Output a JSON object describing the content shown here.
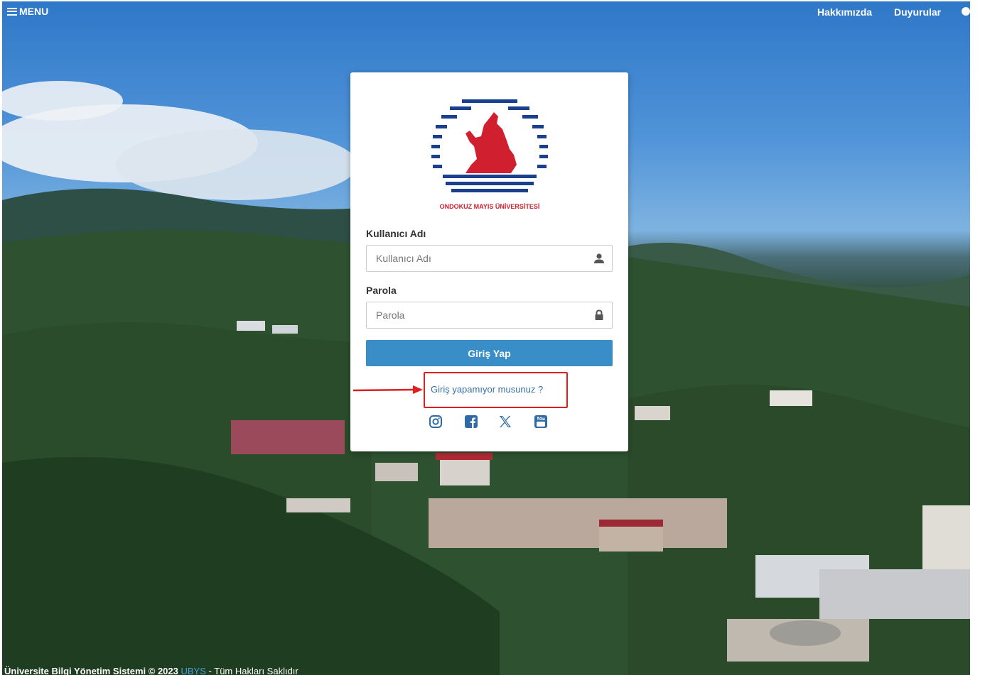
{
  "topbar": {
    "menu_label": "MENU",
    "nav": [
      {
        "label": "Hakkımızda"
      },
      {
        "label": "Duyurular"
      }
    ]
  },
  "login": {
    "logo_text": "ONDOKUZ MAYIS ÜNİVERSİTESİ",
    "username_label": "Kullanıcı Adı",
    "username_placeholder": "Kullanıcı Adı",
    "username_value": "",
    "password_label": "Parola",
    "password_placeholder": "Parola",
    "password_value": "",
    "submit_label": "Giriş Yap",
    "help_link": "Giriş yapamıyor musunuz ?"
  },
  "socials": [
    {
      "icon": "instagram-icon"
    },
    {
      "icon": "facebook-icon"
    },
    {
      "icon": "x-icon"
    },
    {
      "icon": "youtube-icon"
    }
  ],
  "annotation": {
    "highlight_color": "#e11d1d"
  },
  "footer": {
    "system_name": "Üniversite Bilgi Yönetim Sistemi © 2023",
    "brand": "UBYS",
    "rights": "Tüm Hakları Saklıdır"
  },
  "colors": {
    "primary_button": "#3a8ec7",
    "link": "#3a6fa8",
    "logo_blue": "#1b3f8f",
    "logo_red": "#d0202f"
  }
}
